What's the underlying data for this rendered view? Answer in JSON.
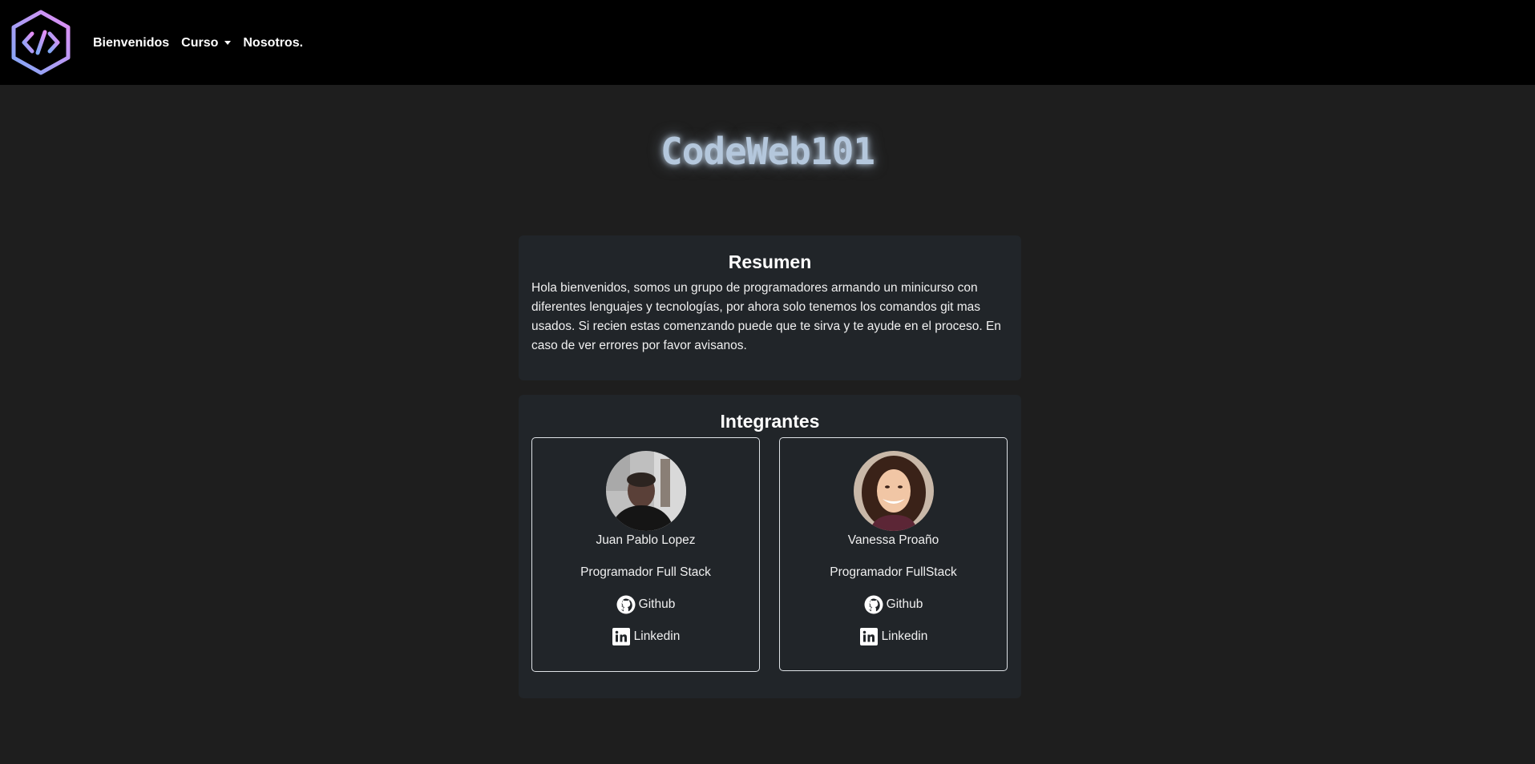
{
  "navbar": {
    "logo_icon": "code-brackets-hexagon-icon",
    "links": [
      {
        "label": "Bienvenidos"
      },
      {
        "label": "Curso"
      },
      {
        "label": "Nosotros."
      }
    ]
  },
  "hero": {
    "title": "CodeWeb101"
  },
  "summary": {
    "title": "Resumen",
    "text": "Hola bienvenidos, somos un grupo de programadores armando un minicurso con diferentes lenguajes y tecnologías, por ahora solo tenemos los comandos git mas usados. Si recien estas comenzando puede que te sirva y te ayude en el proceso. En caso de ver errores por favor avisanos."
  },
  "team": {
    "title": "Integrantes",
    "members": [
      {
        "name": "Juan Pablo Lopez",
        "role": "Programador Full Stack",
        "github_label": "Github",
        "linkedin_label": "Linkedin"
      },
      {
        "name": "Vanessa Proaño",
        "role": "Programador FullStack",
        "github_label": "Github",
        "linkedin_label": "Linkedin"
      }
    ]
  },
  "colors": {
    "background": "#1e1e1e",
    "navbar": "#000000",
    "panel": "#212529",
    "title_glow": "#b4c7dc"
  }
}
